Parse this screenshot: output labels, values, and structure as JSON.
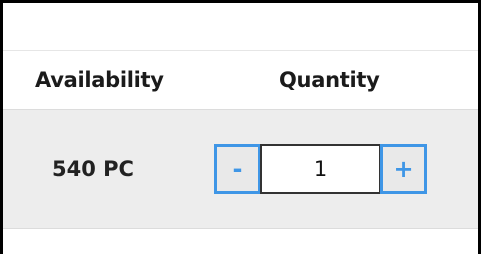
{
  "table": {
    "headers": {
      "availability": "Availability",
      "quantity": "Quantity"
    },
    "row": {
      "availability": "540 PC",
      "quantity": {
        "decrement_label": "-",
        "value": "1",
        "increment_label": "+"
      }
    }
  },
  "colors": {
    "accent": "#3f96e6",
    "row_background": "#ededed",
    "frame_border": "#000000"
  },
  "icons": {
    "decrement": "minus-icon",
    "increment": "plus-icon"
  }
}
